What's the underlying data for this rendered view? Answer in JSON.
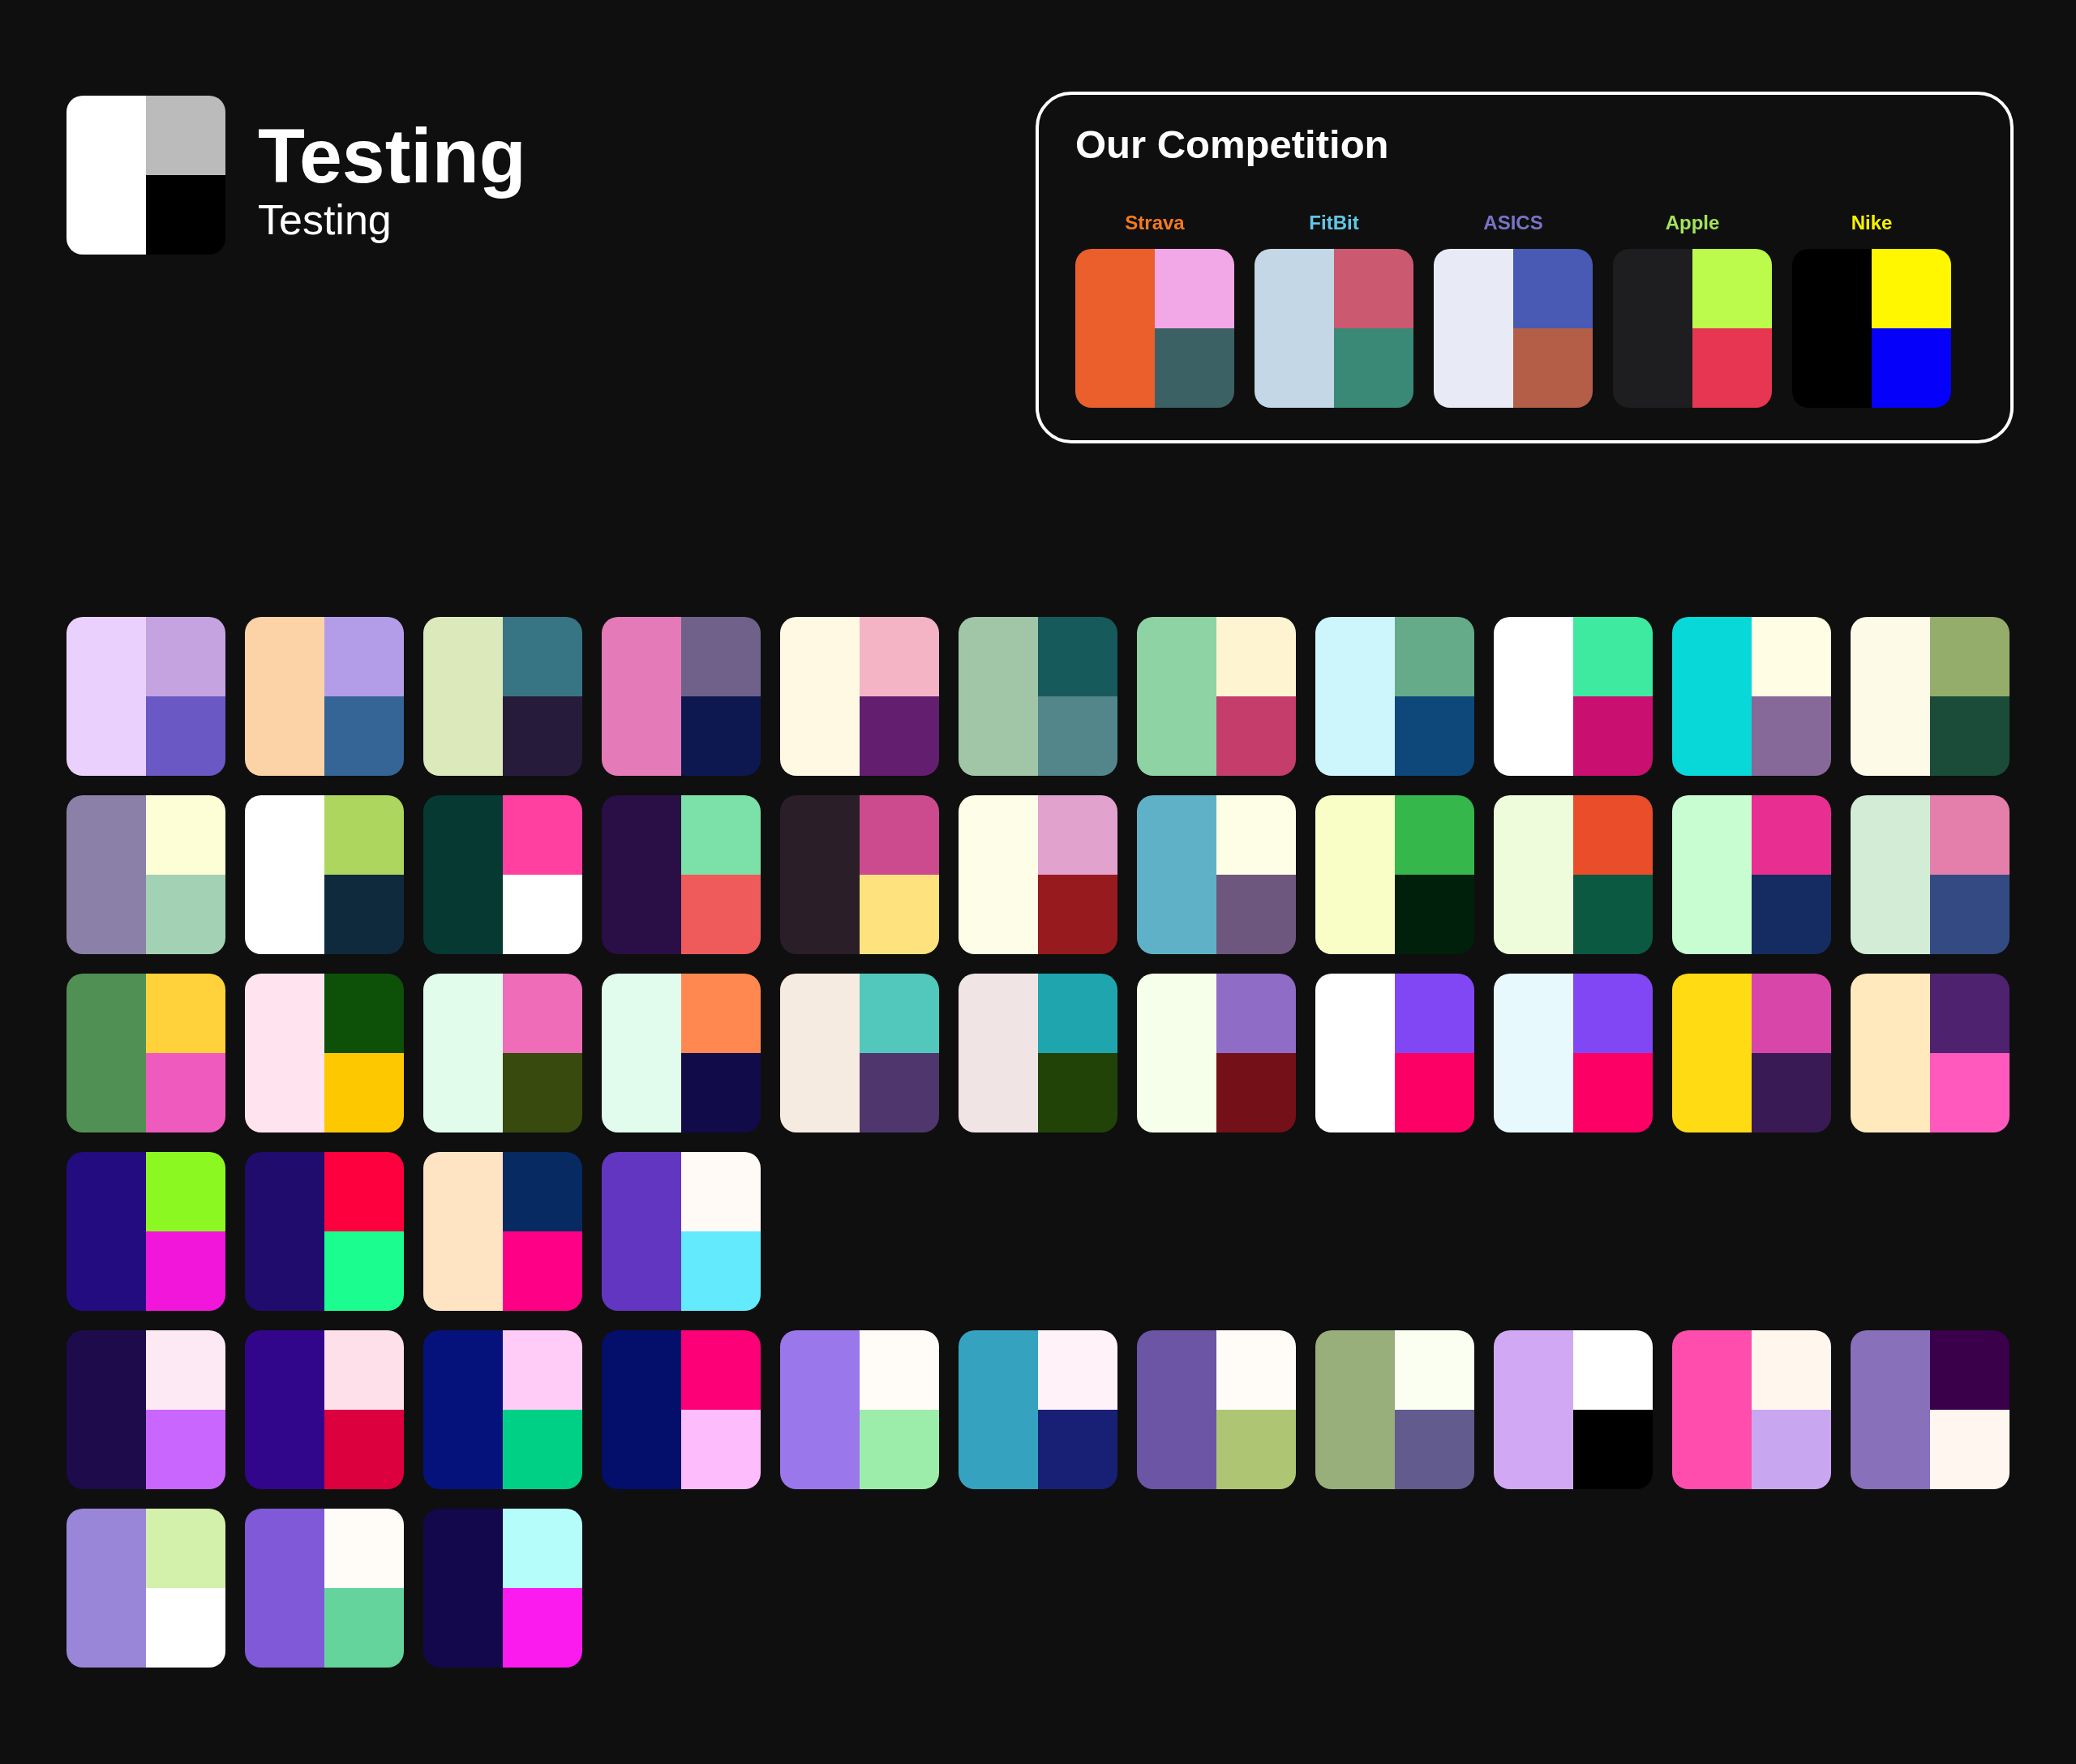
{
  "header": {
    "logo_blocks": [
      {
        "color": "#ffffff"
      },
      {
        "color": "#bbbbbb"
      },
      {
        "color": "#000000"
      }
    ],
    "title": "Testing",
    "subtitle": "Testing"
  },
  "competition": {
    "title": "Our Competition",
    "brands": [
      {
        "name": "Strava",
        "color": "#f47a20",
        "blocks": [
          {
            "color": "#ea5f2c"
          },
          {
            "color": "#f2a8e6"
          },
          {
            "color": "#3b6165"
          }
        ]
      },
      {
        "name": "FitBit",
        "color": "#62c7e4",
        "blocks": [
          {
            "color": "#c3d7e6"
          },
          {
            "color": "#cb5a70"
          },
          {
            "color": "#3a8876"
          }
        ]
      },
      {
        "name": "ASICS",
        "color": "#7a74c6",
        "blocks": [
          {
            "color": "#e8ebf5"
          },
          {
            "color": "#485ab3"
          },
          {
            "color": "#b45e48"
          }
        ]
      },
      {
        "name": "Apple",
        "color": "#a3e35b",
        "blocks": [
          {
            "color": "#1e1e20"
          },
          {
            "color": "#bcfb4b"
          },
          {
            "color": "#e63651"
          }
        ]
      },
      {
        "name": "Nike",
        "color": "#f5f200",
        "blocks": [
          {
            "color": "#000000"
          },
          {
            "color": "#fff700"
          },
          {
            "color": "#0400f9"
          }
        ]
      }
    ]
  },
  "palette_groups": [
    {
      "palettes": [
        {
          "blocks": [
            {
              "color": "#ead1fd"
            },
            {
              "color": "#c4a3e0"
            },
            {
              "color": "#6a58c4"
            }
          ]
        },
        {
          "blocks": [
            {
              "color": "#fcd3a6"
            },
            {
              "color": "#b39de8"
            },
            {
              "color": "#356496"
            }
          ]
        },
        {
          "blocks": [
            {
              "color": "#dceabb"
            },
            {
              "color": "#377585"
            },
            {
              "color": "#271b3b"
            }
          ]
        },
        {
          "blocks": [
            {
              "color": "#e57ab8"
            },
            {
              "color": "#70618a"
            },
            {
              "color": "#0d1850"
            }
          ]
        },
        {
          "blocks": [
            {
              "color": "#fff9e3"
            },
            {
              "color": "#f5b3c6"
            },
            {
              "color": "#641e70"
            }
          ]
        },
        {
          "blocks": [
            {
              "color": "#a0c6a7"
            },
            {
              "color": "#175a5b"
            },
            {
              "color": "#52868b"
            }
          ]
        },
        {
          "blocks": [
            {
              "color": "#8ed3a4"
            },
            {
              "color": "#fff4d1"
            },
            {
              "color": "#c53d6b"
            }
          ]
        },
        {
          "blocks": [
            {
              "color": "#ccf6fb"
            },
            {
              "color": "#66ab89"
            },
            {
              "color": "#0e477a"
            }
          ]
        },
        {
          "blocks": [
            {
              "color": "#ffffff"
            },
            {
              "color": "#3dea9f"
            },
            {
              "color": "#c90f70"
            }
          ]
        },
        {
          "blocks": [
            {
              "color": "#08d8d8"
            },
            {
              "color": "#fffee4"
            },
            {
              "color": "#866999"
            }
          ]
        },
        {
          "blocks": [
            {
              "color": "#fdfae8"
            },
            {
              "color": "#95ad6b"
            },
            {
              "color": "#1a4c39"
            }
          ]
        },
        {
          "blocks": [
            {
              "color": "#8a80a8"
            },
            {
              "color": "#fefed6"
            },
            {
              "color": "#a3d1b3"
            }
          ]
        },
        {
          "blocks": [
            {
              "color": "#ffffff"
            },
            {
              "color": "#acd65e"
            },
            {
              "color": "#0f2a3d"
            }
          ]
        },
        {
          "blocks": [
            {
              "color": "#063931"
            },
            {
              "color": "#ff40a0"
            },
            {
              "color": "#ffffff"
            }
          ]
        },
        {
          "blocks": [
            {
              "color": "#2a0e46"
            },
            {
              "color": "#7ce0a9"
            },
            {
              "color": "#ef5b5b"
            }
          ]
        },
        {
          "blocks": [
            {
              "color": "#2a1f28"
            },
            {
              "color": "#cc4b8e"
            },
            {
              "color": "#fde27e"
            }
          ]
        },
        {
          "blocks": [
            {
              "color": "#fefee8"
            },
            {
              "color": "#e1a2ce"
            },
            {
              "color": "#971b1e"
            }
          ]
        },
        {
          "blocks": [
            {
              "color": "#5fb1c7"
            },
            {
              "color": "#fefee6"
            },
            {
              "color": "#6e577e"
            }
          ]
        },
        {
          "blocks": [
            {
              "color": "#f8fec6"
            },
            {
              "color": "#36b74b"
            },
            {
              "color": "#00200c"
            }
          ]
        },
        {
          "blocks": [
            {
              "color": "#effcdb"
            },
            {
              "color": "#ea4d2a"
            },
            {
              "color": "#0a5940"
            }
          ]
        },
        {
          "blocks": [
            {
              "color": "#c8fdd2"
            },
            {
              "color": "#e92e91"
            },
            {
              "color": "#142c61"
            }
          ]
        },
        {
          "blocks": [
            {
              "color": "#d2ecd6"
            },
            {
              "color": "#e37faa"
            },
            {
              "color": "#334b82"
            }
          ]
        },
        {
          "blocks": [
            {
              "color": "#519055"
            },
            {
              "color": "#ffd23c"
            },
            {
              "color": "#ef5abe"
            }
          ]
        },
        {
          "blocks": [
            {
              "color": "#ffe4f0"
            },
            {
              "color": "#0d5008"
            },
            {
              "color": "#fec801"
            }
          ]
        },
        {
          "blocks": [
            {
              "color": "#e2fcec"
            },
            {
              "color": "#ee6cb8"
            },
            {
              "color": "#384a0d"
            }
          ]
        },
        {
          "blocks": [
            {
              "color": "#e1fcec"
            },
            {
              "color": "#fe8850"
            },
            {
              "color": "#110b4a"
            }
          ]
        },
        {
          "blocks": [
            {
              "color": "#f5ebe0"
            },
            {
              "color": "#52c8bc"
            },
            {
              "color": "#4f376e"
            }
          ]
        },
        {
          "blocks": [
            {
              "color": "#f1e4e5"
            },
            {
              "color": "#1fa5ad"
            },
            {
              "color": "#224307"
            }
          ]
        },
        {
          "blocks": [
            {
              "color": "#f6ffe9"
            },
            {
              "color": "#8f6cc6"
            },
            {
              "color": "#741018"
            }
          ]
        },
        {
          "blocks": [
            {
              "color": "#ffffff"
            },
            {
              "color": "#8247f4"
            },
            {
              "color": "#fd0066"
            }
          ]
        },
        {
          "blocks": [
            {
              "color": "#e8f9fd"
            },
            {
              "color": "#8247f4"
            },
            {
              "color": "#fd0066"
            }
          ]
        },
        {
          "blocks": [
            {
              "color": "#fedb13"
            },
            {
              "color": "#d946aa"
            },
            {
              "color": "#3a1a54"
            }
          ]
        },
        {
          "blocks": [
            {
              "color": "#ffe9bd"
            },
            {
              "color": "#4f2270"
            },
            {
              "color": "#ff59bd"
            }
          ]
        },
        {
          "blocks": [
            {
              "color": "#230c7f"
            },
            {
              "color": "#8cf821"
            },
            {
              "color": "#f116d9"
            }
          ]
        },
        {
          "blocks": [
            {
              "color": "#200c6c"
            },
            {
              "color": "#fe003d"
            },
            {
              "color": "#1bfd8f"
            }
          ]
        },
        {
          "blocks": [
            {
              "color": "#ffe4c4"
            },
            {
              "color": "#062a61"
            },
            {
              "color": "#fe0085"
            }
          ]
        },
        {
          "blocks": [
            {
              "color": "#6236c0"
            },
            {
              "color": "#fffaf6"
            },
            {
              "color": "#64eafd"
            }
          ]
        }
      ]
    },
    {
      "palettes": [
        {
          "blocks": [
            {
              "color": "#1d0b4b"
            },
            {
              "color": "#fde9f3"
            },
            {
              "color": "#c966fe"
            }
          ]
        },
        {
          "blocks": [
            {
              "color": "#32068a"
            },
            {
              "color": "#fde0ea"
            },
            {
              "color": "#dc003f"
            }
          ]
        },
        {
          "blocks": [
            {
              "color": "#06127c"
            },
            {
              "color": "#ffcbf7"
            },
            {
              "color": "#00cf86"
            }
          ]
        },
        {
          "blocks": [
            {
              "color": "#030f6b"
            },
            {
              "color": "#fd0077"
            },
            {
              "color": "#fdbdfc"
            }
          ]
        },
        {
          "blocks": [
            {
              "color": "#9b77ec"
            },
            {
              "color": "#fffcf8"
            },
            {
              "color": "#9dedaa"
            }
          ]
        },
        {
          "blocks": [
            {
              "color": "#35a3c0"
            },
            {
              "color": "#fff2f9"
            },
            {
              "color": "#172075"
            }
          ]
        },
        {
          "blocks": [
            {
              "color": "#6b55a4"
            },
            {
              "color": "#fffcf8"
            },
            {
              "color": "#aec674"
            }
          ]
        },
        {
          "blocks": [
            {
              "color": "#98ae7b"
            },
            {
              "color": "#fbfff2"
            },
            {
              "color": "#625b8d"
            }
          ]
        },
        {
          "blocks": [
            {
              "color": "#d1a8f4"
            },
            {
              "color": "#ffffff"
            },
            {
              "color": "#000000"
            }
          ]
        },
        {
          "blocks": [
            {
              "color": "#fe4dad"
            },
            {
              "color": "#fff7ee"
            },
            {
              "color": "#c8a7f0"
            }
          ]
        },
        {
          "blocks": [
            {
              "color": "#8870bb"
            },
            {
              "color": "#3a004a"
            },
            {
              "color": "#fff6ef"
            }
          ]
        },
        {
          "blocks": [
            {
              "color": "#9a86d8"
            },
            {
              "color": "#d4f1ac"
            },
            {
              "color": "#ffffff"
            }
          ]
        },
        {
          "blocks": [
            {
              "color": "#8059d9"
            },
            {
              "color": "#fffbf6"
            },
            {
              "color": "#64d49c"
            }
          ]
        },
        {
          "blocks": [
            {
              "color": "#12084b"
            },
            {
              "color": "#b5fdfb"
            },
            {
              "color": "#fb1bef"
            }
          ]
        }
      ]
    }
  ]
}
